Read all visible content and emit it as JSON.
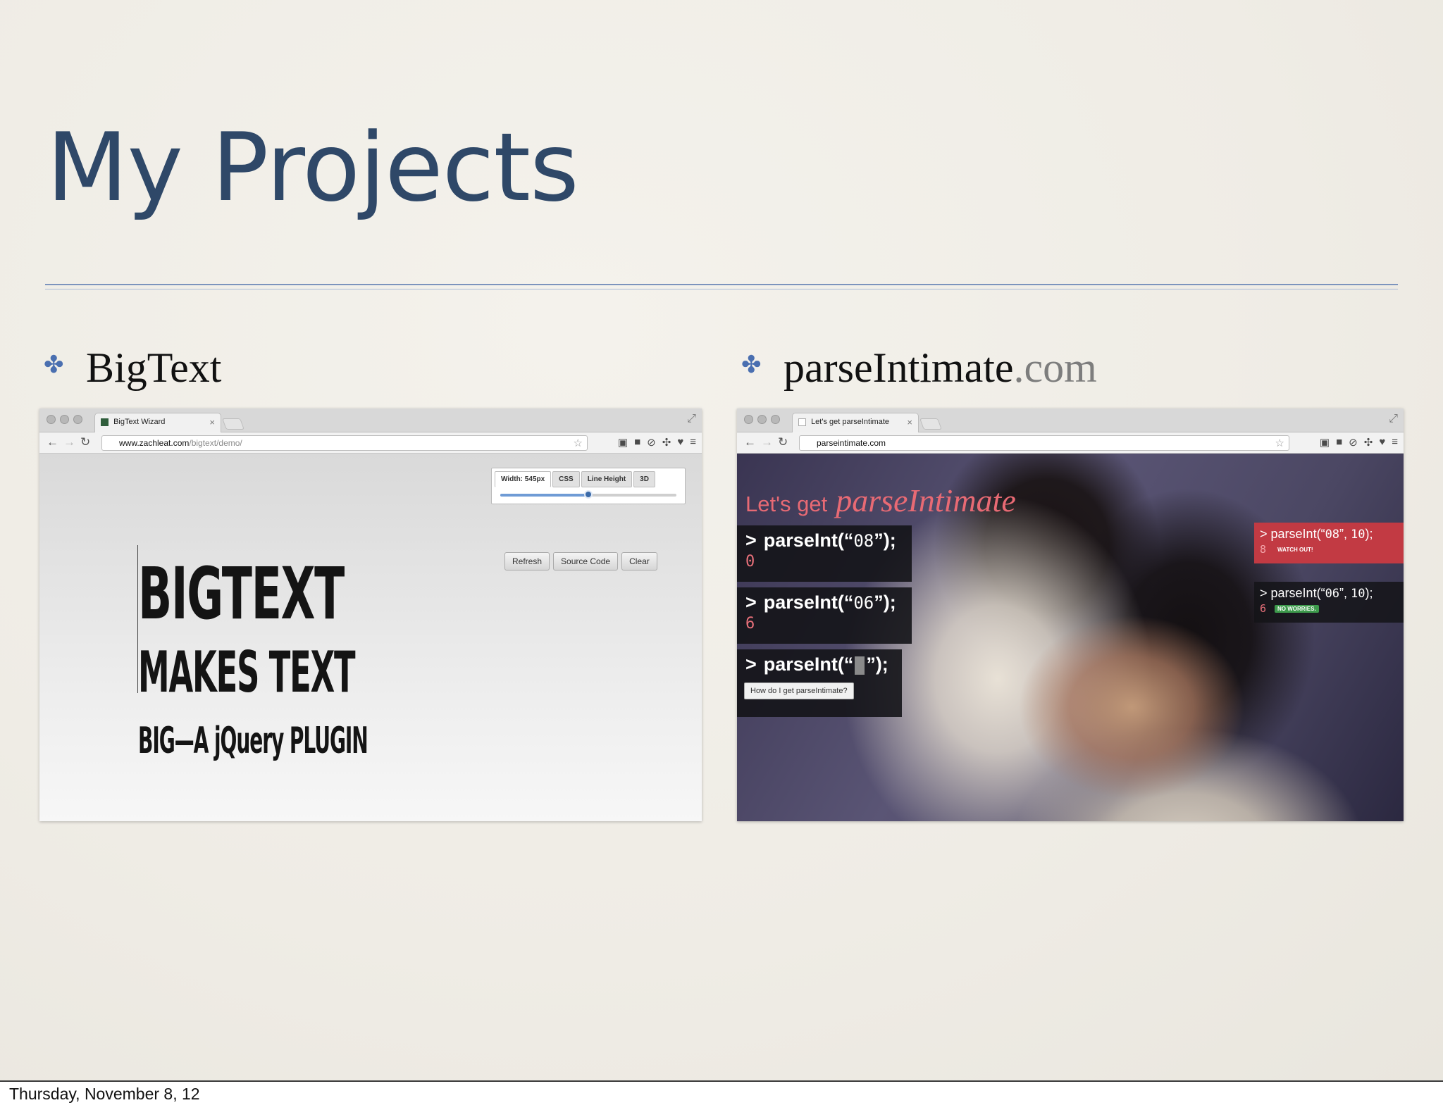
{
  "slide": {
    "title": "My Projects",
    "date": "Thursday, November 8, 12"
  },
  "bullets": [
    {
      "mark": "✤",
      "label": "BigText",
      "suffix": ""
    },
    {
      "mark": "✤",
      "label": "parseIntimate",
      "suffix": ".com"
    }
  ],
  "bigtext_window": {
    "tab_title": "BigText Wizard",
    "url_host": "www.zachleat.com",
    "url_path": "/bigtext/demo/",
    "panel": {
      "tabs": [
        "Width: 545px",
        "CSS",
        "Line Height",
        "3D"
      ],
      "slider_value": 0.5
    },
    "buttons": [
      "Refresh",
      "Source Code",
      "Clear"
    ],
    "headline": [
      "BIGTEXT",
      "MAKES TEXT",
      "BIG—A jQuery PLUGIN"
    ]
  },
  "parseintimate_window": {
    "tab_title": "Let's get parseIntimate",
    "url": "parseintimate.com",
    "heading_prefix": "Let's get",
    "heading_script": "parseIntimate",
    "rows": [
      {
        "prompt": ">",
        "call": "parseInt(“",
        "arg": "08",
        "close": "”);",
        "result": "0"
      },
      {
        "prompt": ">",
        "call": "parseInt(“",
        "arg": "06",
        "close": "”);",
        "result": "6"
      },
      {
        "prompt": ">",
        "call": "parseInt(“",
        "close": "”);",
        "help_button": "How do I get parseIntimate?"
      }
    ],
    "side": [
      {
        "prompt": ">",
        "call": "parseInt(“",
        "arg": "08",
        "sep": "”, ",
        "radix": "10",
        "close": ");",
        "result": "8",
        "badge": "WATCH OUT!"
      },
      {
        "prompt": ">",
        "call": "parseInt(“",
        "arg": "06",
        "sep": "”, ",
        "radix": "10",
        "close": ");",
        "result": "6",
        "badge": "NO WORRIES."
      }
    ]
  },
  "colors": {
    "title": "#2f4868",
    "bullet_mark": "#4a6fb0",
    "pi_accent": "#e86a74",
    "warn_bg": "#c23a43",
    "ok_badge": "#3d9a4c"
  }
}
